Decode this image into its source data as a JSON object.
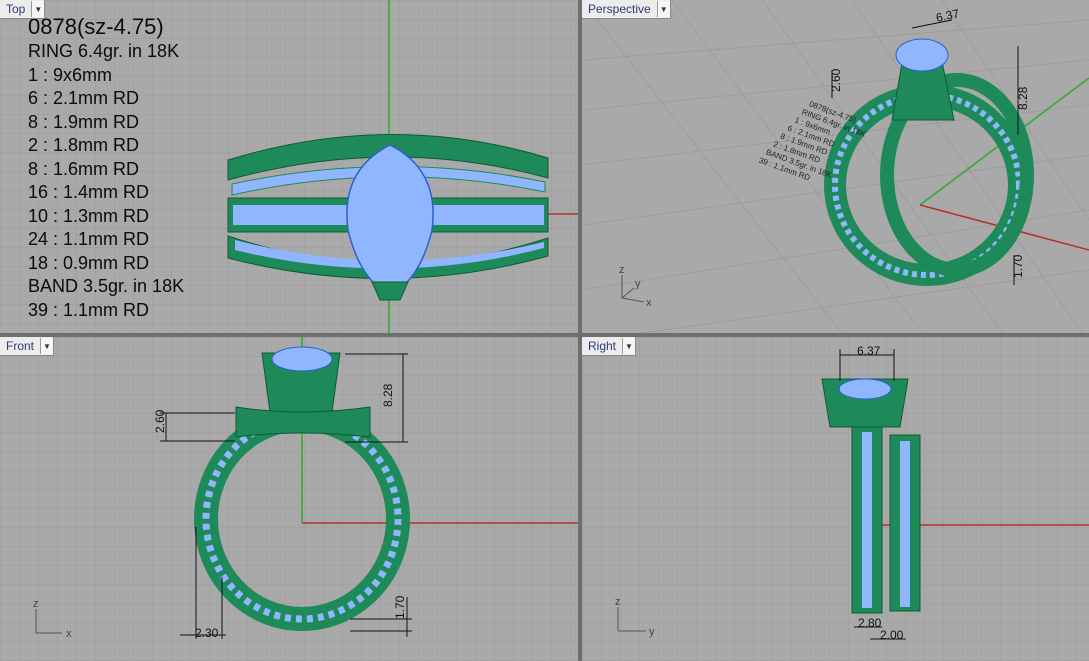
{
  "viewports": {
    "top": {
      "label": "Top"
    },
    "perspective": {
      "label": "Perspective"
    },
    "front": {
      "label": "Front"
    },
    "right": {
      "label": "Right"
    }
  },
  "notes": {
    "title": "0878(sz-4.75)",
    "ring": "RING 6.4gr.  in 18K",
    "stones": [
      "1 : 9x6mm",
      "6 : 2.1mm RD",
      "8 : 1.9mm RD",
      "2 : 1.8mm RD",
      "8 : 1.6mm RD",
      "16 : 1.4mm RD",
      "10 : 1.3mm RD",
      "24 : 1.1mm RD",
      "18 : 0.9mm RD"
    ],
    "band": "BAND 3.5gr.  in 18K",
    "band_stones": "39 : 1.1mm RD"
  },
  "dimensions": {
    "persp_width": "6.37",
    "persp_height": "8.28",
    "persp_side": "2.60",
    "persp_shank": "1.70",
    "front_height": "8.28",
    "front_side": "2.60",
    "front_shank": "2.30",
    "front_bottom": "1.70",
    "right_width": "6.37",
    "right_a": "2.80",
    "right_b": "2.00"
  },
  "axes": {
    "x": "x",
    "y": "y",
    "z": "z"
  },
  "colors": {
    "metal": "#1e8a5a",
    "metal_dark": "#12603c",
    "stone": "#8fb6ff",
    "grid_bg": "#a9a9a9",
    "grid_line": "#9a9a9a",
    "axis_x": "#b5322a",
    "axis_y": "#2faa2f"
  }
}
